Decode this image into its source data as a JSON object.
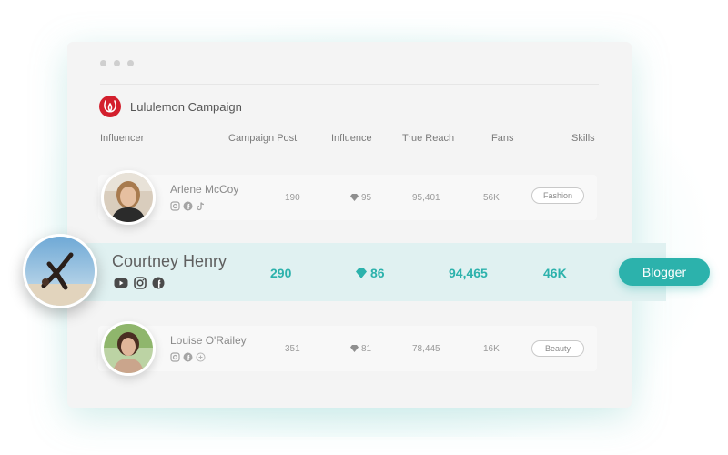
{
  "campaign": {
    "title": "Lululemon Campaign",
    "logo_icon": "lululemon-logo-icon",
    "brand_color": "#d31f2d"
  },
  "columns": [
    "Influencer",
    "Campaign Post",
    "Influence",
    "True Reach",
    "Fans",
    "Skills"
  ],
  "rows": [
    {
      "name": "Arlene McCoy",
      "campaign_post": "190",
      "influence": "95",
      "true_reach": "95,401",
      "fans": "56K",
      "skill": "Fashion",
      "socials": [
        "instagram-icon",
        "facebook-icon",
        "tiktok-icon"
      ]
    },
    {
      "name": "Louise O'Railey",
      "campaign_post": "351",
      "influence": "81",
      "true_reach": "78,445",
      "fans": "16K",
      "skill": "Beauty",
      "socials": [
        "instagram-icon",
        "facebook-icon",
        "add-icon"
      ]
    }
  ],
  "highlight": {
    "name": "Courtney Henry",
    "campaign_post": "290",
    "influence": "86",
    "true_reach": "94,465",
    "fans": "46K",
    "tag": "Blogger",
    "socials": [
      "youtube-icon",
      "instagram-icon",
      "facebook-icon"
    ]
  },
  "colors": {
    "accent": "#2cb2ac",
    "highlight_bg": "#e0f1f1"
  }
}
